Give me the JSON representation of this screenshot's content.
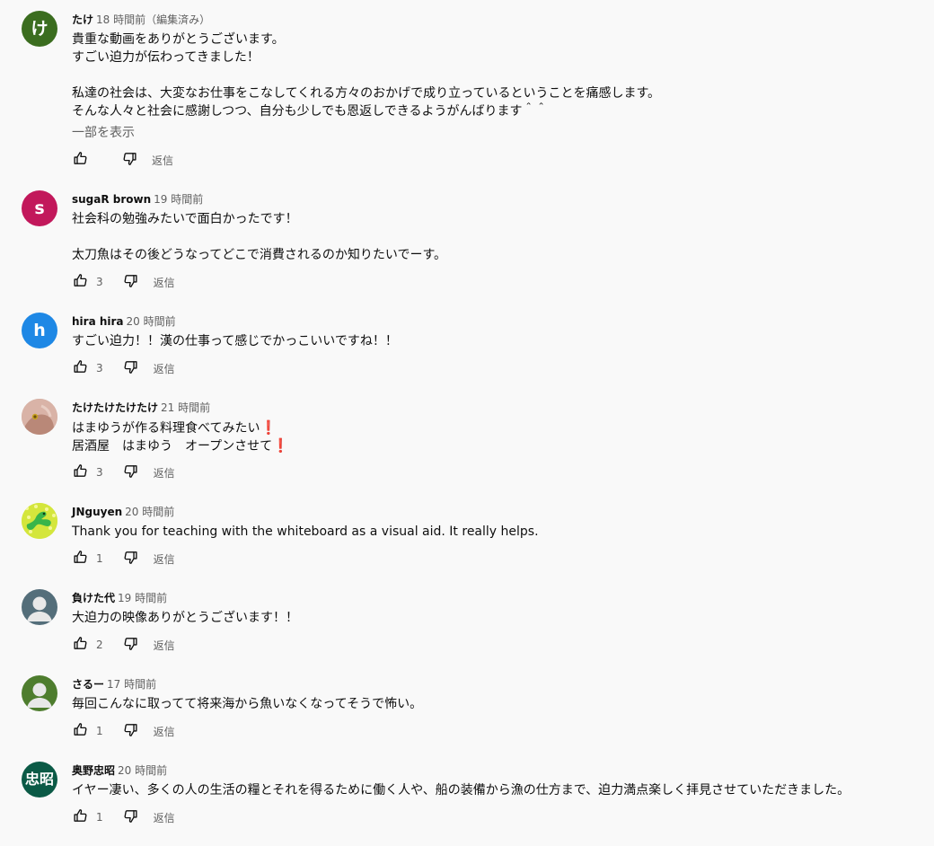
{
  "ui": {
    "reply_label": "返信",
    "show_more_label": "一部を表示",
    "colors": {
      "background": "#f9f9f9",
      "text": "#0f0f0f",
      "secondary_text": "#606060",
      "emoji_red": "#e0202a"
    }
  },
  "comments": [
    {
      "author": "たけ",
      "time": "18 時間前（編集済み）",
      "avatar": {
        "type": "letter",
        "text": "け",
        "color": "#3b6d1f"
      },
      "lines": [
        "貴重な動画をありがとうございます。",
        "すごい迫力が伝わってきました！",
        "",
        "私達の社会は、大変なお仕事をこなしてくれる方々のおかげで成り立っているということを痛感します。",
        "そんな人々と社会に感謝しつつ、自分も少しでも恩返しできるようがんばります＾＾"
      ],
      "likes": ""
    },
    {
      "author": "sugaR brown",
      "time": "19 時間前",
      "avatar": {
        "type": "letter",
        "text": "s",
        "color": "#c2185b"
      },
      "lines": [
        "社会科の勉強みたいで面白かったです！",
        "",
        "太刀魚はその後どうなってどこで消費されるのか知りたいでーす。"
      ],
      "likes": "3"
    },
    {
      "author": "hira hira",
      "time": "20 時間前",
      "avatar": {
        "type": "letter",
        "text": "h",
        "color": "#1e88e5"
      },
      "lines": [
        "すごい迫力！！漢の仕事って感じでかっこいいですね！！"
      ],
      "likes": "3"
    },
    {
      "author": "たけたけたけたけ",
      "time": "21 時間前",
      "avatar": {
        "type": "photo-hand",
        "color": "#c8a596"
      },
      "lines": [
        "はまゆうが作る料理食べてみたい",
        "居酒屋　はまゆう　オープンさせて"
      ],
      "line_emoji": "❗",
      "likes": "3"
    },
    {
      "author": "JNguyen",
      "time": "20 時間前",
      "avatar": {
        "type": "pattern-green",
        "color": "#cde23a"
      },
      "lines": [
        "Thank you for teaching with the whiteboard as a visual aid. It really helps."
      ],
      "likes": "1"
    },
    {
      "author": "負けた代",
      "time": "19 時間前",
      "avatar": {
        "type": "default-person",
        "color": "#546e7a"
      },
      "lines": [
        "大迫力の映像ありがとうございます！！"
      ],
      "likes": "2"
    },
    {
      "author": "さるー",
      "time": "17 時間前",
      "avatar": {
        "type": "default-person",
        "color": "#4e7d2e"
      },
      "lines": [
        "毎回こんなに取ってて将来海から魚いなくなってそうで怖い。"
      ],
      "likes": "1"
    },
    {
      "author": "奥野忠昭",
      "time": "20 時間前",
      "avatar": {
        "type": "letter",
        "text": "忠昭",
        "color": "#0b5a46"
      },
      "lines": [
        "イヤー凄い、多くの人の生活の糧とそれを得るために働く人や、船の装備から漁の仕方まで、迫力満点楽しく拝見させていただきました。"
      ],
      "likes": "1"
    }
  ]
}
